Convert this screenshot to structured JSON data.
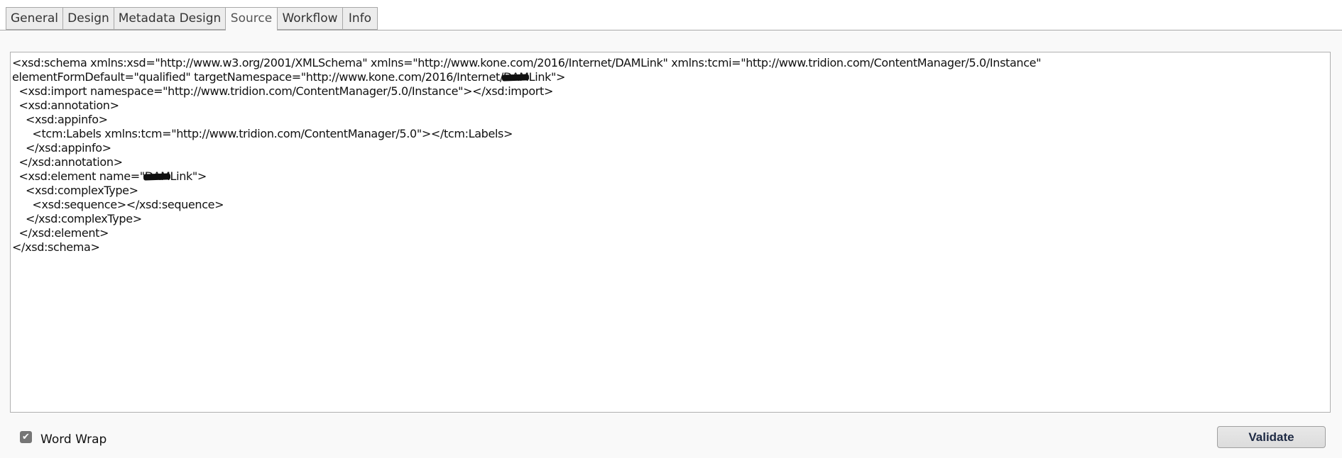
{
  "tabs": [
    {
      "label": "General",
      "active": false
    },
    {
      "label": "Design",
      "active": false
    },
    {
      "label": "Metadata Design",
      "active": false
    },
    {
      "label": "Source",
      "active": true
    },
    {
      "label": "Workflow",
      "active": false
    },
    {
      "label": "Info",
      "active": false
    }
  ],
  "editor": {
    "lines": [
      {
        "indent": "",
        "text": "<xsd:schema xmlns:xsd=\"http://www.w3.org/2001/XMLSchema\" xmlns=\"http://www.kone.com/2016/Internet/DAMLink\" xmlns:tcmi=\"http://www.tridion.com/ContentManager/5.0/Instance\""
      },
      {
        "indent": "",
        "before": "elementFormDefault=\"qualified\" targetNamespace=\"http://www.kone.com/2016/Internet/",
        "redacted": "DAM",
        "after": "Link\">"
      },
      {
        "indent": "  ",
        "text": "<xsd:import namespace=\"http://www.tridion.com/ContentManager/5.0/Instance\"></xsd:import>"
      },
      {
        "indent": "  ",
        "text": "<xsd:annotation>"
      },
      {
        "indent": "    ",
        "text": "<xsd:appinfo>"
      },
      {
        "indent": "      ",
        "text": "<tcm:Labels xmlns:tcm=\"http://www.tridion.com/ContentManager/5.0\"></tcm:Labels>"
      },
      {
        "indent": "    ",
        "text": "</xsd:appinfo>"
      },
      {
        "indent": "  ",
        "text": "</xsd:annotation>"
      },
      {
        "indent": "  ",
        "before": "<xsd:element name=\"",
        "redacted": "DAM",
        "after": "Link\">"
      },
      {
        "indent": "    ",
        "text": "<xsd:complexType>"
      },
      {
        "indent": "      ",
        "text": "<xsd:sequence></xsd:sequence>"
      },
      {
        "indent": "    ",
        "text": "</xsd:complexType>"
      },
      {
        "indent": "  ",
        "text": "</xsd:element>"
      },
      {
        "indent": "",
        "text": "</xsd:schema>"
      }
    ]
  },
  "footer": {
    "word_wrap_label": "Word Wrap",
    "word_wrap_checked": true,
    "checkmark_glyph": "✔",
    "validate_label": "Validate"
  }
}
